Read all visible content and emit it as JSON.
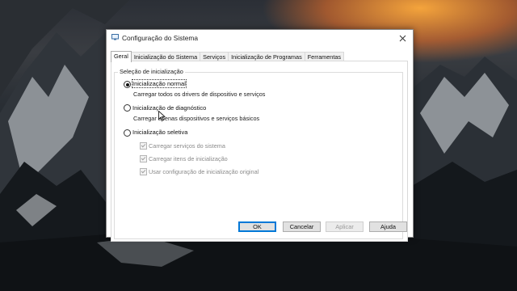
{
  "window": {
    "title": "Configuração do Sistema",
    "close_glyph": "✕"
  },
  "tabs": [
    {
      "label": "Geral",
      "active": true
    },
    {
      "label": "Inicialização do Sistema"
    },
    {
      "label": "Serviços"
    },
    {
      "label": "Inicialização de Programas"
    },
    {
      "label": "Ferramentas"
    }
  ],
  "startup": {
    "group_label": "Seleção de inicialização",
    "normal": {
      "label": "Inicialização normal",
      "description": "Carregar todos os drivers de dispositivo e serviços",
      "selected": true
    },
    "diagnostic": {
      "label": "Inicialização de diagnóstico",
      "description": "Carregar apenas dispositivos e serviços básicos",
      "selected": false
    },
    "selective": {
      "label": "Inicialização seletiva",
      "selected": false,
      "options": [
        {
          "label": "Carregar serviços do sistema",
          "checked": true
        },
        {
          "label": "Carregar itens de inicialização",
          "checked": true
        },
        {
          "label": "Usar configuração de inicialização original",
          "checked": true
        }
      ]
    }
  },
  "buttons": {
    "ok": "OK",
    "cancel": "Cancelar",
    "apply": "Aplicar",
    "help": "Ajuda"
  },
  "colors": {
    "accent": "#0078d7",
    "window_bg": "#ffffff",
    "button_bg": "#e1e1e1"
  }
}
